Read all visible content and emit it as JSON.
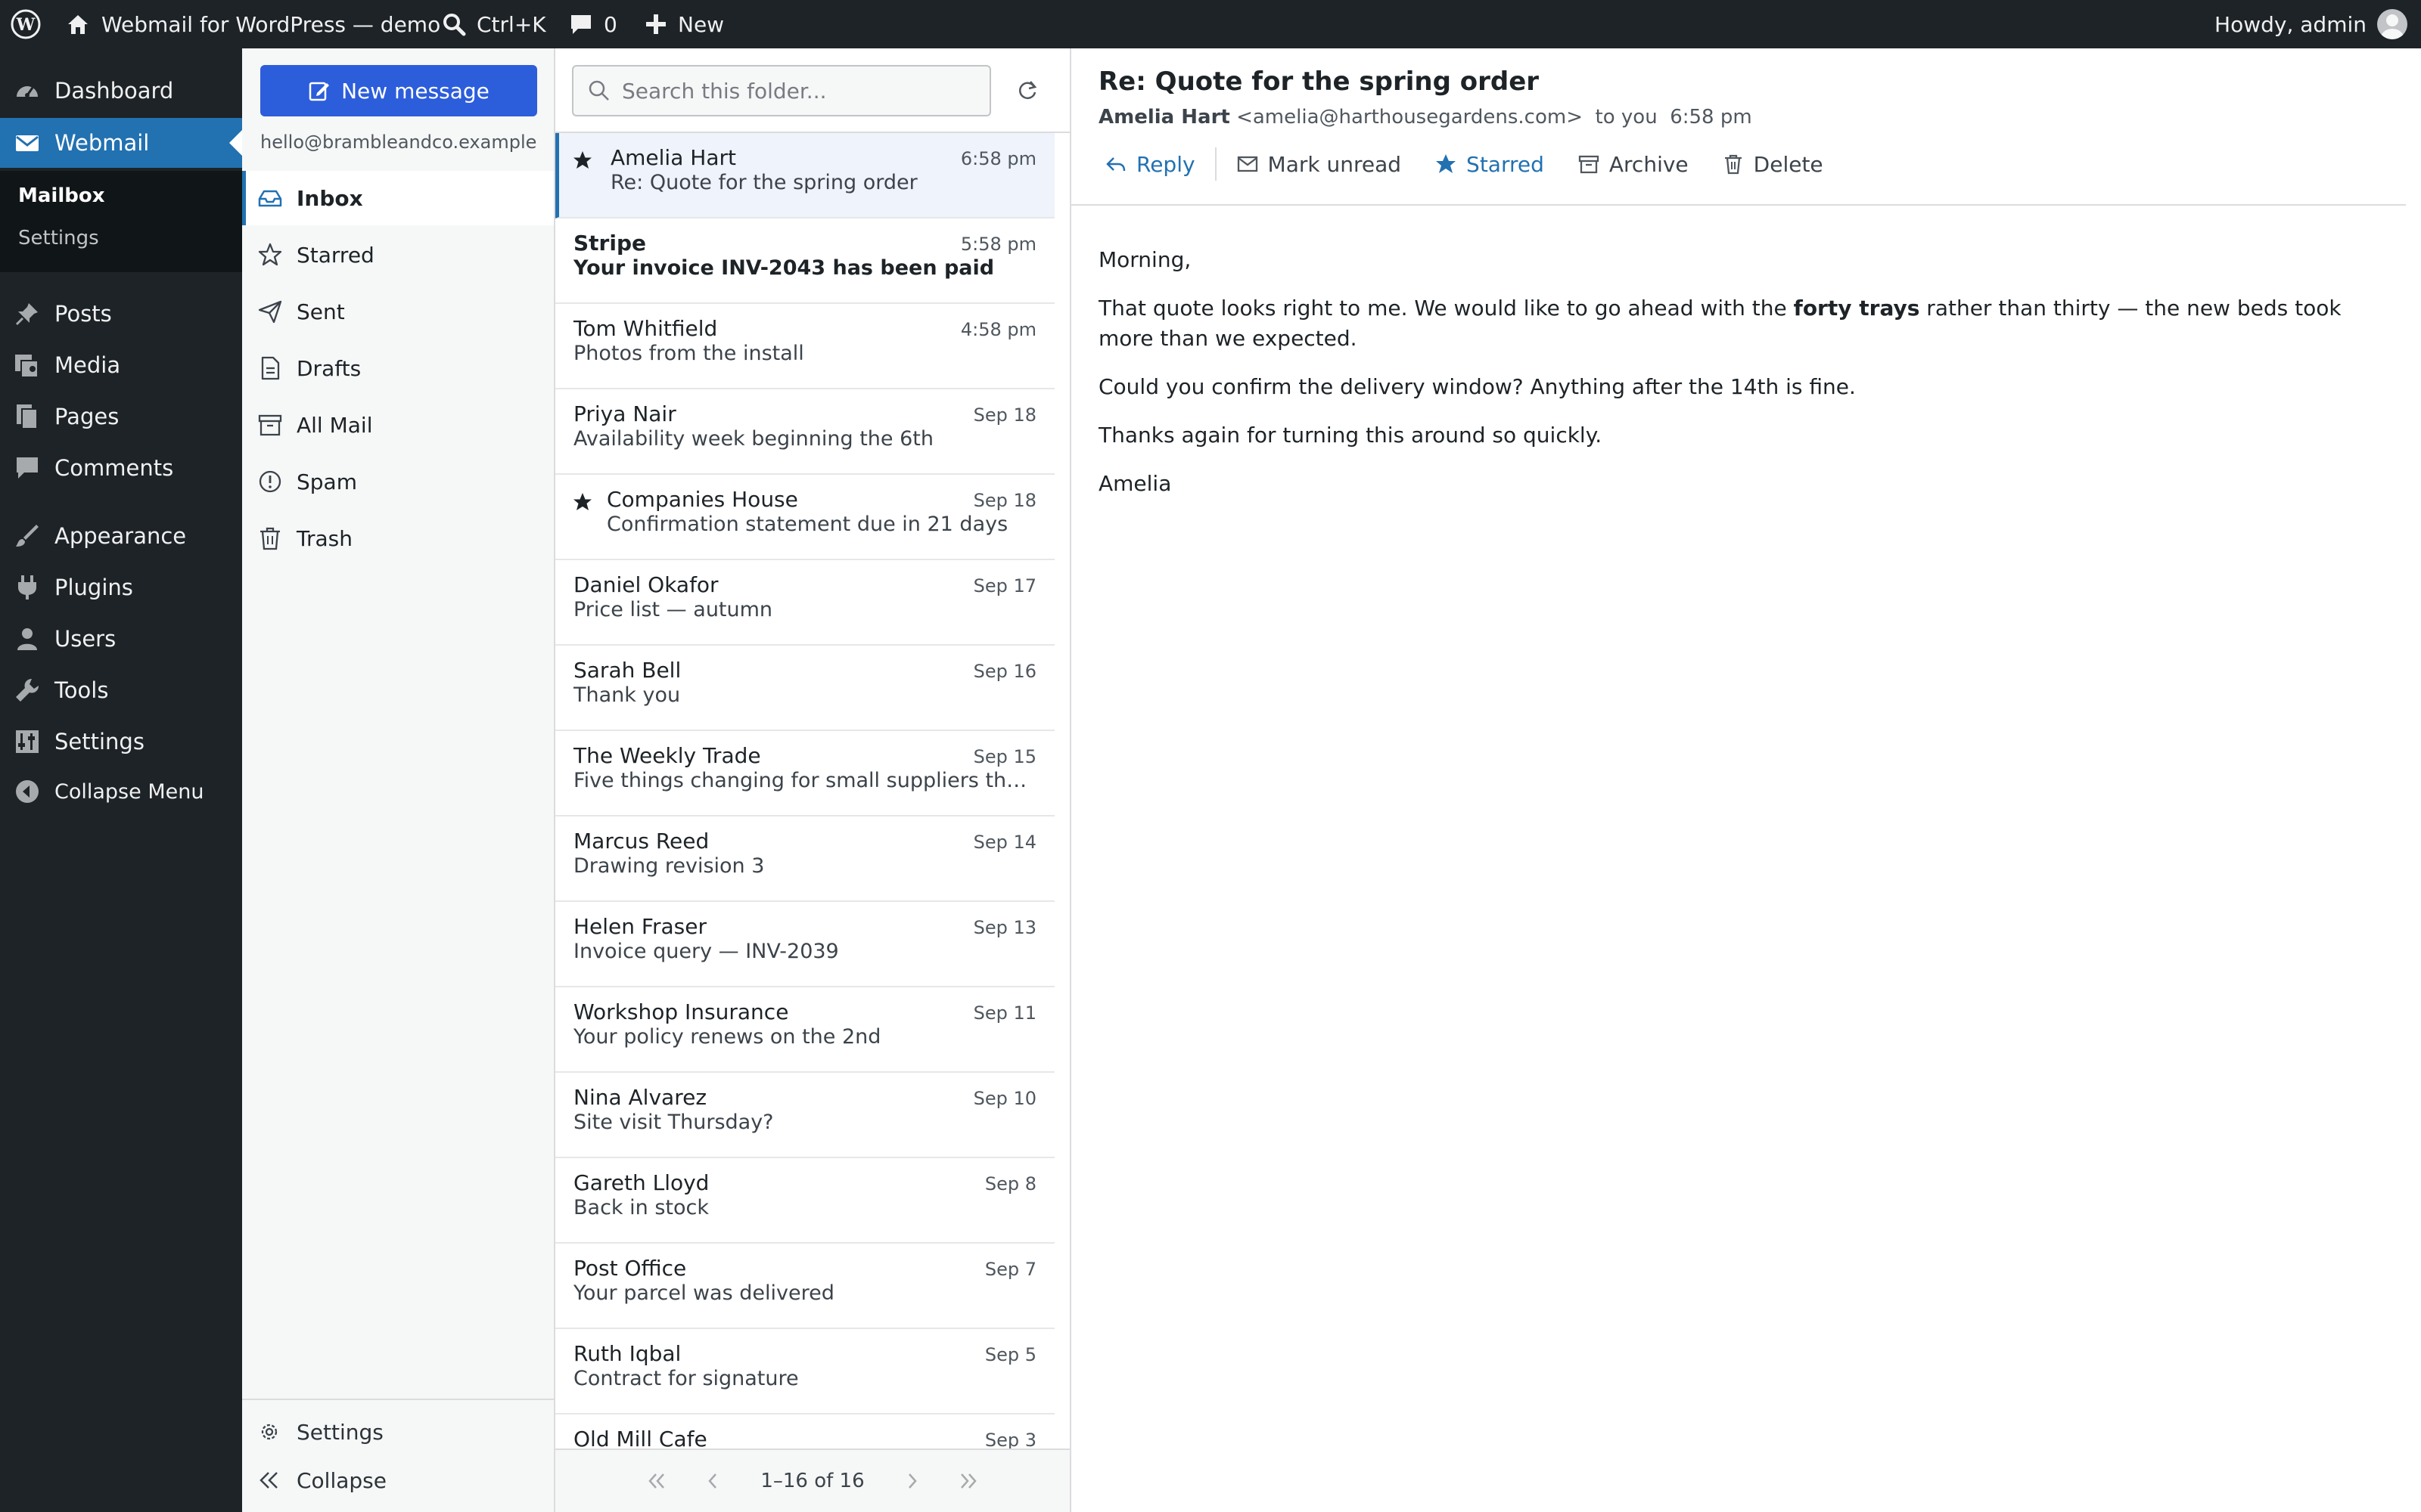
{
  "adminbar": {
    "site_name": "Webmail for WordPress — demo",
    "search_shortcut": "Ctrl+K",
    "comment_count": "0",
    "new_label": "New",
    "howdy": "Howdy, admin"
  },
  "wp_menu": {
    "items": [
      {
        "label": "Dashboard",
        "icon": "dashboard-icon"
      },
      {
        "label": "Webmail",
        "icon": "mail-icon"
      },
      {
        "label": "Posts",
        "icon": "pin-icon"
      },
      {
        "label": "Media",
        "icon": "media-icon"
      },
      {
        "label": "Pages",
        "icon": "pages-icon"
      },
      {
        "label": "Comments",
        "icon": "comment-icon"
      },
      {
        "label": "Appearance",
        "icon": "brush-icon"
      },
      {
        "label": "Plugins",
        "icon": "plugin-icon"
      },
      {
        "label": "Users",
        "icon": "user-icon"
      },
      {
        "label": "Tools",
        "icon": "wrench-icon"
      },
      {
        "label": "Settings",
        "icon": "sliders-icon"
      },
      {
        "label": "Collapse Menu",
        "icon": "collapse-icon"
      }
    ],
    "submenu": [
      {
        "label": "Mailbox"
      },
      {
        "label": "Settings"
      }
    ]
  },
  "folders": {
    "new_message": "New message",
    "account": "hello@brambleandco.example",
    "items": [
      {
        "label": "Inbox",
        "icon": "inbox-icon"
      },
      {
        "label": "Starred",
        "icon": "star-icon"
      },
      {
        "label": "Sent",
        "icon": "send-icon"
      },
      {
        "label": "Drafts",
        "icon": "draft-icon"
      },
      {
        "label": "All Mail",
        "icon": "archive-icon"
      },
      {
        "label": "Spam",
        "icon": "spam-icon"
      },
      {
        "label": "Trash",
        "icon": "trash-icon"
      }
    ],
    "footer": [
      {
        "label": "Settings",
        "icon": "gear-icon"
      },
      {
        "label": "Collapse",
        "icon": "double-chevron-left-icon"
      }
    ]
  },
  "list": {
    "search_placeholder": "Search this folder...",
    "messages": [
      {
        "sender": "Amelia Hart",
        "subject": "Re: Quote for the spring order",
        "time": "6:58 pm",
        "starred": true,
        "unread": false,
        "selected": true
      },
      {
        "sender": "Stripe",
        "subject": "Your invoice INV-2043 has been paid",
        "time": "5:58 pm",
        "starred": false,
        "unread": true,
        "selected": false
      },
      {
        "sender": "Tom Whitfield",
        "subject": "Photos from the install",
        "time": "4:58 pm",
        "starred": false,
        "unread": false,
        "selected": false
      },
      {
        "sender": "Priya Nair",
        "subject": "Availability week beginning the 6th",
        "time": "Sep 18",
        "starred": false,
        "unread": false,
        "selected": false
      },
      {
        "sender": "Companies House",
        "subject": "Confirmation statement due in 21 days",
        "time": "Sep 18",
        "starred": true,
        "unread": false,
        "selected": false
      },
      {
        "sender": "Daniel Okafor",
        "subject": "Price list — autumn",
        "time": "Sep 17",
        "starred": false,
        "unread": false,
        "selected": false
      },
      {
        "sender": "Sarah Bell",
        "subject": "Thank you",
        "time": "Sep 16",
        "starred": false,
        "unread": false,
        "selected": false
      },
      {
        "sender": "The Weekly Trade",
        "subject": "Five things changing for small suppliers this q...",
        "time": "Sep 15",
        "starred": false,
        "unread": false,
        "selected": false
      },
      {
        "sender": "Marcus Reed",
        "subject": "Drawing revision 3",
        "time": "Sep 14",
        "starred": false,
        "unread": false,
        "selected": false
      },
      {
        "sender": "Helen Fraser",
        "subject": "Invoice query — INV-2039",
        "time": "Sep 13",
        "starred": false,
        "unread": false,
        "selected": false
      },
      {
        "sender": "Workshop Insurance",
        "subject": "Your policy renews on the 2nd",
        "time": "Sep 11",
        "starred": false,
        "unread": false,
        "selected": false
      },
      {
        "sender": "Nina Alvarez",
        "subject": "Site visit Thursday?",
        "time": "Sep 10",
        "starred": false,
        "unread": false,
        "selected": false
      },
      {
        "sender": "Gareth Lloyd",
        "subject": "Back in stock",
        "time": "Sep 8",
        "starred": false,
        "unread": false,
        "selected": false
      },
      {
        "sender": "Post Office",
        "subject": "Your parcel was delivered",
        "time": "Sep 7",
        "starred": false,
        "unread": false,
        "selected": false
      },
      {
        "sender": "Ruth Iqbal",
        "subject": "Contract for signature",
        "time": "Sep 5",
        "starred": false,
        "unread": false,
        "selected": false
      },
      {
        "sender": "Old Mill Cafe",
        "subject": "",
        "time": "Sep 3",
        "starred": false,
        "unread": false,
        "selected": false
      }
    ],
    "pager_text": "1–16 of 16"
  },
  "reader": {
    "subject": "Re: Quote for the spring order",
    "from_name": "Amelia Hart",
    "from_email": "<amelia@harthousegardens.com>",
    "to": "to you",
    "time": "6:58 pm",
    "toolbar": {
      "reply": "Reply",
      "mark_unread": "Mark unread",
      "starred": "Starred",
      "archive": "Archive",
      "delete": "Delete"
    },
    "body": {
      "greeting": "Morning,",
      "p1_before": "That quote looks right to me. We would like to go ahead with the ",
      "p1_bold": "forty trays",
      "p1_after": " rather than thirty — the new beds took more than we expected.",
      "p2": "Could you confirm the delivery window? Anything after the 14th is fine.",
      "p3": "Thanks again for turning this around so quickly.",
      "signoff": "Amelia"
    }
  },
  "colors": {
    "admin_bg": "#1d2327",
    "accent": "#2271b1",
    "new_button": "#2c5ddb",
    "selected_row": "#eef3fc"
  }
}
